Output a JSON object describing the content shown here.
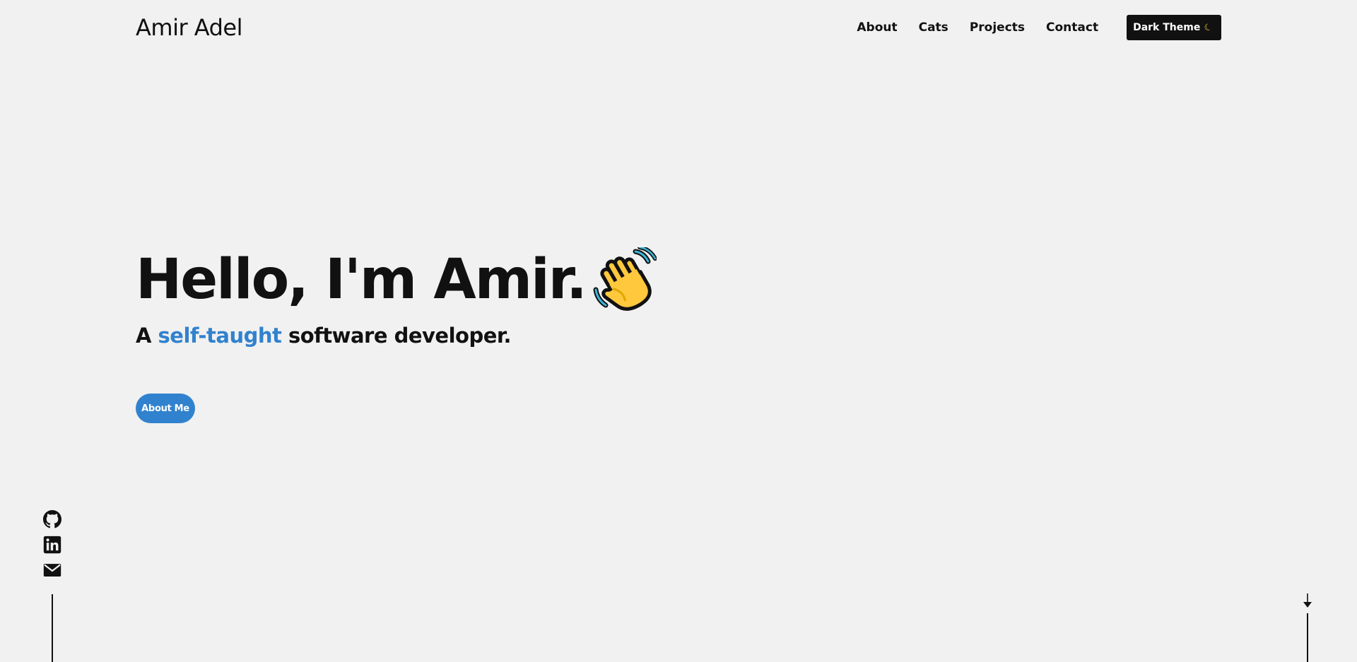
{
  "header": {
    "brand": "Amir Adel",
    "nav": [
      {
        "label": "About"
      },
      {
        "label": "Cats"
      },
      {
        "label": "Projects"
      },
      {
        "label": "Contact"
      }
    ],
    "theme_button": {
      "label": "Dark Theme",
      "icon": "moon-icon"
    }
  },
  "hero": {
    "title": "Hello, I'm Amir.",
    "title_icon": "waving-hand-icon",
    "subtitle_prefix": "A ",
    "subtitle_accent": "self-taught",
    "subtitle_suffix": " software developer.",
    "cta_label": "About Me"
  },
  "social": [
    {
      "icon": "github-icon"
    },
    {
      "icon": "linkedin-icon"
    },
    {
      "icon": "mail-icon"
    }
  ],
  "scroll_indicator": {
    "icon": "arrow-down-icon"
  },
  "colors": {
    "background": "#f1f1f1",
    "text": "#111111",
    "accent": "#3182ce",
    "dark_button": "#111111"
  }
}
